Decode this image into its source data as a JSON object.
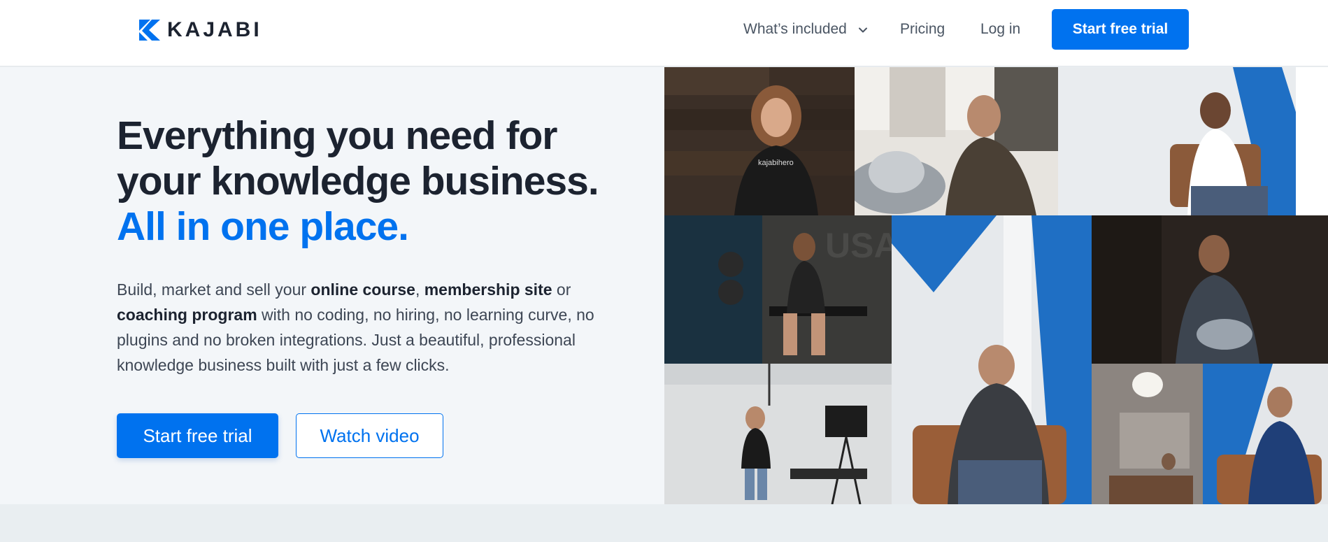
{
  "header": {
    "logo_text": "KAJABI",
    "nav": {
      "included": "What’s included",
      "pricing": "Pricing",
      "login": "Log in"
    },
    "cta": "Start free trial"
  },
  "hero": {
    "headline_line1": "Everything you need for",
    "headline_line2": "your knowledge business.",
    "headline_accent": "All in one place.",
    "desc": {
      "part1": "Build, market and sell your ",
      "bold1": "online course",
      "part2": ", ",
      "bold2": "membership site",
      "part3": " or ",
      "bold3": "coaching program",
      "part4": " with no coding, no hiring, no learning curve, no plugins and no broken integrations. Just a beautiful, professional knowledge business built with just a few clicks."
    },
    "primary_button": "Start free trial",
    "secondary_button": "Watch video"
  },
  "collage": {
    "shirt_text": "kajabihero"
  },
  "colors": {
    "brand_blue": "#0072ef",
    "dark_text": "#1c2330",
    "hero_bg": "#f3f6f9"
  },
  "icons": {
    "logo_mark": "kajabi-k-logo-icon",
    "nav_chevron": "chevron-down-icon"
  }
}
